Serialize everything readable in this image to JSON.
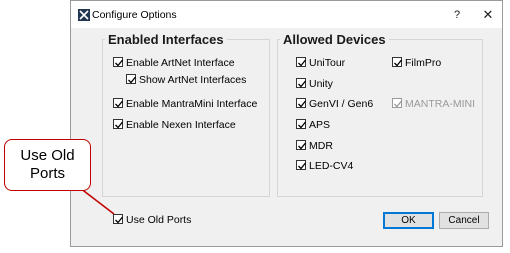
{
  "window": {
    "title": "Configure Options",
    "help_label": "?",
    "close_label": "✕"
  },
  "interfaces": {
    "heading": "Enabled Interfaces",
    "items": [
      {
        "label": "Enable ArtNet Interface",
        "checked": true
      },
      {
        "label": "Show ArtNet Interfaces",
        "checked": true
      },
      {
        "label": "Enable MantraMini Interface",
        "checked": true
      },
      {
        "label": "Enable Nexen Interface",
        "checked": true
      }
    ]
  },
  "devices": {
    "heading": "Allowed Devices",
    "items": [
      {
        "label": "UniTour",
        "checked": true
      },
      {
        "label": "Unity",
        "checked": true
      },
      {
        "label": "GenVI / Gen6",
        "checked": true
      },
      {
        "label": "APS",
        "checked": true
      },
      {
        "label": "MDR",
        "checked": true
      },
      {
        "label": "LED-CV4",
        "checked": true
      },
      {
        "label": "FilmPro",
        "checked": true
      },
      {
        "label": "MANTRA-MINI",
        "checked": true,
        "disabled": true
      }
    ]
  },
  "use_old_ports": {
    "label": "Use Old Ports",
    "checked": true
  },
  "buttons": {
    "ok": "OK",
    "cancel": "Cancel"
  },
  "callout": {
    "line1": "Use Old",
    "line2": "Ports",
    "border_color": "#c00000"
  },
  "colors": {
    "accent": "#0078d7"
  }
}
